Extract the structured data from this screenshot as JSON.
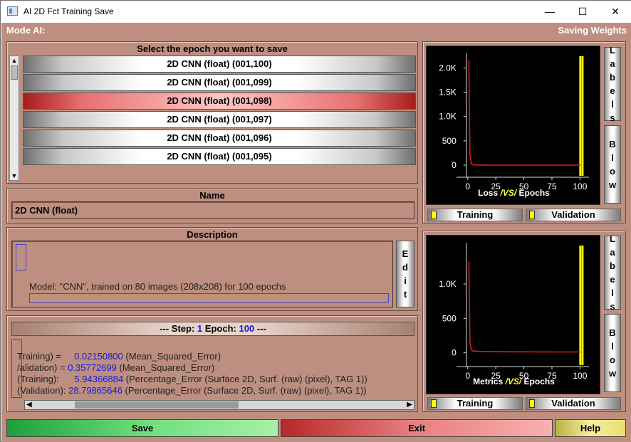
{
  "window": {
    "title": "AI 2D Fct Training Save",
    "minimize": "—",
    "maximize": "☐",
    "close": "✕"
  },
  "header": {
    "left": "Mode AI:",
    "right": "Saving Weights"
  },
  "epochs": {
    "title": "Select the epoch you want to save",
    "items": [
      {
        "label": "2D CNN (float) (001,100)",
        "selected": false
      },
      {
        "label": "2D CNN (float) (001,099)",
        "selected": false
      },
      {
        "label": "2D CNN (float) (001,098)",
        "selected": true
      },
      {
        "label": "2D CNN (float) (001,097)",
        "selected": false
      },
      {
        "label": "2D CNN (float) (001,096)",
        "selected": false
      },
      {
        "label": "2D CNN (float) (001,095)",
        "selected": false
      }
    ]
  },
  "name": {
    "title": "Name",
    "value": "2D CNN (float)"
  },
  "description": {
    "title": "Description",
    "text": "Model: \"CNN\", trained on 80 images (208x208) for 100 epochs",
    "edit": "Edit"
  },
  "step": {
    "step_label": "--- Step:",
    "step_value": "1",
    "epoch_label": "Epoch:",
    "epoch_value": "100",
    "tail": "---",
    "lines": [
      {
        "pre": "Training) =     ",
        "num": "0.02150800",
        "post": " (Mean_Squared_Error)"
      },
      {
        "pre": "/alidation) = ",
        "num": "0.35772699",
        "post": " (Mean_Squared_Error)"
      },
      {
        "pre": "(Training):      ",
        "num": "5.94366884",
        "post": " (Percentage_Error (Surface 2D, Surf. (raw) (pixel), TAG 1))"
      },
      {
        "pre": "(Validation): ",
        "num": "28.79865646",
        "post": " (Percentage_Error (Surface 2D, Surf. (raw) (pixel), TAG 1))"
      }
    ]
  },
  "loss_chart": {
    "labels_btn": "Labels",
    "blow_btn": "Blow",
    "title_a": "Loss ",
    "title_vs": "/VS/",
    "title_b": " Epochs",
    "training": "Training",
    "validation": "Validation"
  },
  "metrics_chart": {
    "labels_btn": "Labels",
    "blow_btn": "Blow",
    "title_a": "Metrics ",
    "title_vs": "/VS/",
    "title_b": " Epochs",
    "training": "Training",
    "validation": "Validation"
  },
  "buttons": {
    "save": "Save",
    "exit": "Exit",
    "help": "Help"
  },
  "colors": {
    "line": "#cc2020",
    "highlight": "#ffff00",
    "vs": "#ffff33"
  },
  "chart_data": [
    {
      "type": "line",
      "title": "Loss /VS/ Epochs",
      "xlabel": "Epochs",
      "ylabel": "Loss",
      "x_ticks": [
        "0",
        "25",
        "50",
        "75",
        "100"
      ],
      "y_ticks": [
        "0",
        "500",
        "1.0K",
        "1.5K",
        "2.0K"
      ],
      "xlim": [
        -10,
        108
      ],
      "ylim": [
        -250,
        2300
      ],
      "series": [
        {
          "name": "Training",
          "x": [
            1,
            2,
            3,
            4,
            5,
            10,
            20,
            30,
            40,
            50,
            60,
            70,
            80,
            90,
            100
          ],
          "values": [
            2150,
            200,
            40,
            10,
            5,
            2,
            1,
            1,
            1,
            1,
            1,
            1,
            1,
            1,
            1
          ]
        }
      ],
      "marker_x": 100
    },
    {
      "type": "line",
      "title": "Metrics /VS/ Epochs",
      "xlabel": "Epochs",
      "ylabel": "Metrics",
      "x_ticks": [
        "0",
        "25",
        "50",
        "75",
        "100"
      ],
      "y_ticks": [
        "0",
        "500",
        "1.0K"
      ],
      "xlim": [
        -10,
        108
      ],
      "ylim": [
        -200,
        1600
      ],
      "series": [
        {
          "name": "Training",
          "x": [
            1,
            2,
            3,
            4,
            5,
            10,
            20,
            30,
            40,
            50,
            60,
            70,
            80,
            90,
            100
          ],
          "values": [
            1320,
            150,
            60,
            35,
            25,
            20,
            18,
            15,
            14,
            14,
            13,
            13,
            12,
            12,
            12
          ]
        }
      ],
      "marker_x": 100
    }
  ]
}
